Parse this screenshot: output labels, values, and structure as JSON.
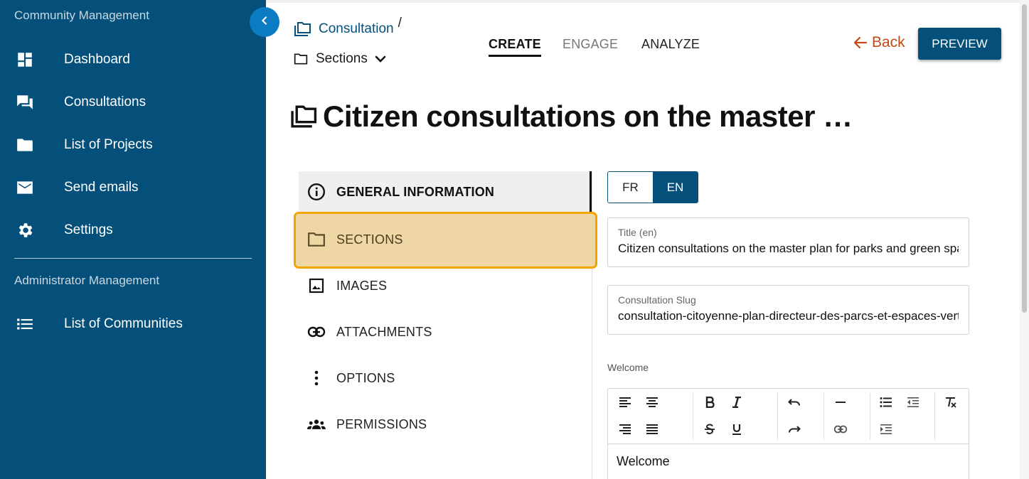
{
  "sidebar": {
    "section_community": "Community Management",
    "section_admin": "Administrator Management",
    "items": [
      {
        "label": "Dashboard",
        "icon": "dashboard-icon"
      },
      {
        "label": "Consultations",
        "icon": "forum-icon"
      },
      {
        "label": "List of Projects",
        "icon": "folder-icon"
      },
      {
        "label": "Send emails",
        "icon": "mail-icon"
      },
      {
        "label": "Settings",
        "icon": "gear-icon"
      },
      {
        "label": "List of Communities",
        "icon": "list-icon"
      }
    ],
    "collapse_icon": "chevron-left-icon"
  },
  "breadcrumb": {
    "consultation": "Consultation",
    "separator": "/",
    "sections": "Sections"
  },
  "tabs": {
    "create": "CREATE",
    "engage": "ENGAGE",
    "analyze": "ANALYZE",
    "active": "CREATE"
  },
  "actions": {
    "back": "Back",
    "preview": "PREVIEW"
  },
  "page_title": "Citizen consultations on the master …",
  "menu": {
    "items": [
      {
        "label": "GENERAL INFORMATION",
        "icon": "info-icon"
      },
      {
        "label": "SECTIONS",
        "icon": "folder-outline-icon"
      },
      {
        "label": "IMAGES",
        "icon": "image-icon"
      },
      {
        "label": "ATTACHMENTS",
        "icon": "link-icon"
      },
      {
        "label": "OPTIONS",
        "icon": "more-vertical-icon"
      },
      {
        "label": "PERMISSIONS",
        "icon": "group-icon"
      }
    ],
    "highlighted": "SECTIONS"
  },
  "lang": {
    "fr": "FR",
    "en": "EN",
    "active": "EN"
  },
  "form": {
    "title_label": "Title (en)",
    "title_value": "Citizen consultations on the master plan for parks and green spaces",
    "slug_label": "Consultation Slug",
    "slug_value": "consultation-citoyenne-plan-directeur-des-parcs-et-espaces-verts",
    "welcome_label": "Welcome",
    "welcome_content": "Welcome"
  },
  "colors": {
    "sidebar_bg": "#04507a",
    "accent_blue": "#0b7bc2",
    "back_orange": "#c24a12",
    "highlight_border": "#f0a500",
    "highlight_fill": "#efd7a5"
  }
}
